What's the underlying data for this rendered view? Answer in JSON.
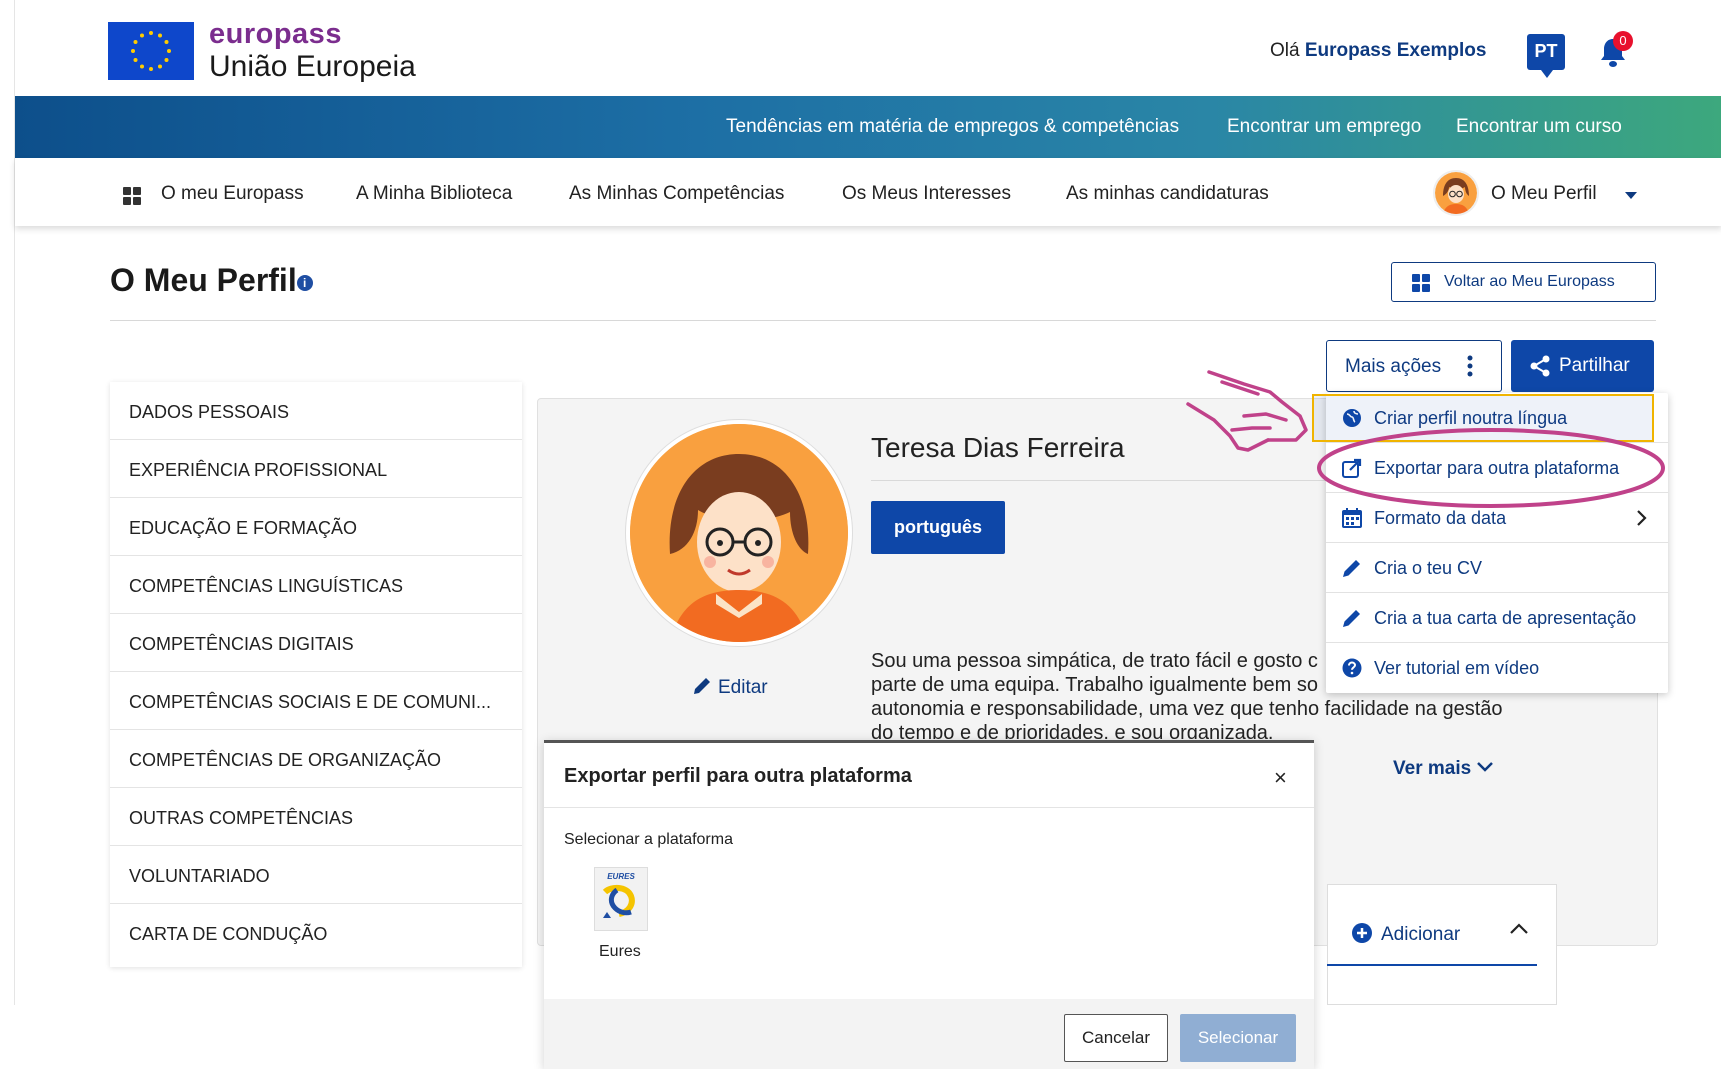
{
  "header": {
    "brand_name": "europass",
    "brand_sub": "União Europeia",
    "greeting_prefix": "Olá",
    "greeting_user": "Europass Exemplos",
    "language": "PT",
    "notification_count": "0"
  },
  "band_links": [
    {
      "label": "Tendências em matéria de empregos & competências"
    },
    {
      "label": "Encontrar um emprego"
    },
    {
      "label": "Encontrar um curso"
    }
  ],
  "nav": {
    "items": [
      {
        "label": "O meu Europass"
      },
      {
        "label": "A Minha Biblioteca"
      },
      {
        "label": "As Minhas Competências"
      },
      {
        "label": "Os Meus Interesses"
      },
      {
        "label": "As minhas candidaturas"
      }
    ],
    "profile_label": "O Meu Perfil"
  },
  "page": {
    "title": "O Meu Perfil",
    "info_icon": "i",
    "back_button": "Voltar ao Meu Europass",
    "more_actions": "Mais ações",
    "share": "Partilhar"
  },
  "sidebar": {
    "items": [
      {
        "label": "DADOS PESSOAIS"
      },
      {
        "label": "EXPERIÊNCIA PROFISSIONAL"
      },
      {
        "label": "EDUCAÇÃO E FORMAÇÃO"
      },
      {
        "label": "COMPETÊNCIAS LINGUÍSTICAS"
      },
      {
        "label": "COMPETÊNCIAS DIGITAIS"
      },
      {
        "label": "COMPETÊNCIAS SOCIAIS E DE COMUNI..."
      },
      {
        "label": "COMPETÊNCIAS DE ORGANIZAÇÃO"
      },
      {
        "label": "OUTRAS COMPETÊNCIAS"
      },
      {
        "label": "VOLUNTARIADO"
      },
      {
        "label": "CARTA DE CONDUÇÃO"
      }
    ]
  },
  "profile": {
    "name": "Teresa Dias Ferreira",
    "language": "português",
    "edit": "Editar",
    "bio": "Sou uma pessoa simpática, de trato fácil e gosto de trabalhar em equipa. Trabalho igualmente bem sozinha, com autonomia e responsabilidade, uma vez que tenho facilidade na gestão do tempo e de prioridades, e sou organizada.",
    "bio_lines": [
      "Sou uma pessoa simpática, de trato fácil e gosto c",
      "parte de uma equipa. Trabalho igualmente bem so",
      "autonomia e responsabilidade, uma vez que tenho facilidade na gestão",
      "do tempo e de prioridades, e sou organizada."
    ],
    "see_more": "Ver mais",
    "add": "Adicionar"
  },
  "dropdown": {
    "items": [
      {
        "label": "Criar perfil noutra língua",
        "icon": "globe-icon"
      },
      {
        "label": "Exportar para outra plataforma",
        "icon": "export-icon"
      },
      {
        "label": "Formato da data",
        "icon": "calendar-icon"
      },
      {
        "label": "Cria o teu CV",
        "icon": "pencil-icon"
      },
      {
        "label": "Cria a tua carta de apresentação",
        "icon": "pencil-icon"
      },
      {
        "label": "Ver tutorial em vídeo",
        "icon": "question-icon"
      }
    ]
  },
  "modal": {
    "title": "Exportar perfil para outra plataforma",
    "close": "×",
    "select_label": "Selecionar a plataforma",
    "logo_text": "EURES",
    "platform": "Eures",
    "cancel": "Cancelar",
    "select": "Selecionar"
  },
  "colors": {
    "brand_purple": "#7b2d8e",
    "primary_blue": "#0e47a8",
    "annotation_pink": "#c0428a",
    "highlight_border": "#f0b400"
  }
}
